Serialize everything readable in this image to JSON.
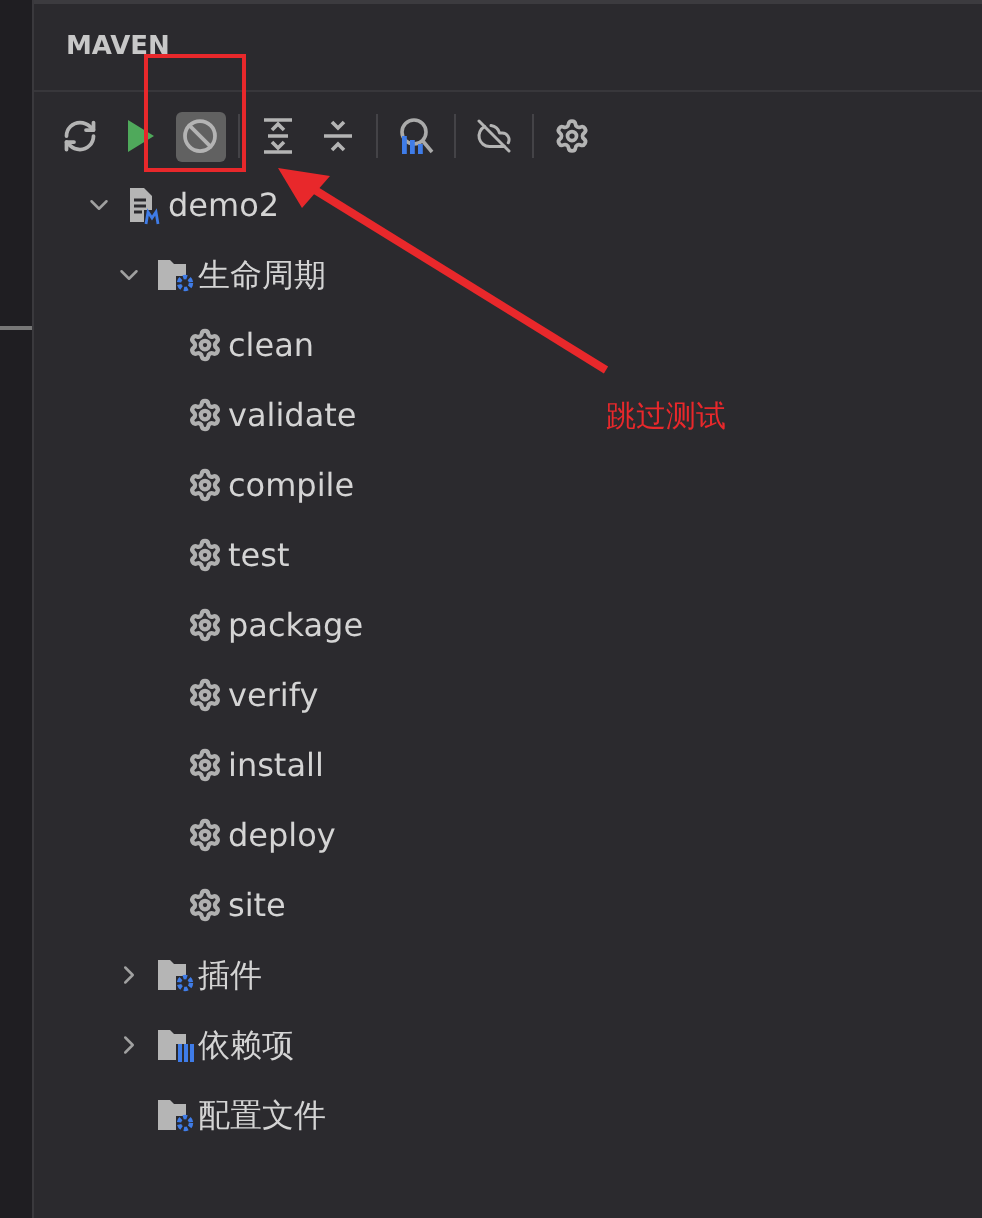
{
  "panel": {
    "title": "MAVEN"
  },
  "toolbar": [
    {
      "kind": "reload",
      "selected": false
    },
    {
      "kind": "run",
      "selected": false
    },
    {
      "kind": "skip-tests",
      "selected": true
    },
    {
      "kind": "divider"
    },
    {
      "kind": "expand",
      "selected": false
    },
    {
      "kind": "collapse",
      "selected": false
    },
    {
      "kind": "divider"
    },
    {
      "kind": "analyze",
      "selected": false
    },
    {
      "kind": "divider"
    },
    {
      "kind": "offline",
      "selected": false
    },
    {
      "kind": "divider"
    },
    {
      "kind": "settings",
      "selected": false
    }
  ],
  "tree": [
    {
      "label": "demo2",
      "kind": "project",
      "expanded": true,
      "children": [
        {
          "label": "生命周期",
          "kind": "folder",
          "expanded": true,
          "children": [
            {
              "label": "clean",
              "kind": "goal"
            },
            {
              "label": "validate",
              "kind": "goal"
            },
            {
              "label": "compile",
              "kind": "goal"
            },
            {
              "label": "test",
              "kind": "goal"
            },
            {
              "label": "package",
              "kind": "goal"
            },
            {
              "label": "verify",
              "kind": "goal"
            },
            {
              "label": "install",
              "kind": "goal"
            },
            {
              "label": "deploy",
              "kind": "goal"
            },
            {
              "label": "site",
              "kind": "goal"
            }
          ]
        },
        {
          "label": "插件",
          "kind": "folder",
          "expanded": false
        },
        {
          "label": "依赖项",
          "kind": "dependencies",
          "expanded": false
        },
        {
          "label": "配置文件",
          "kind": "folder"
        }
      ]
    }
  ],
  "annotation": {
    "label": "跳过测试"
  }
}
